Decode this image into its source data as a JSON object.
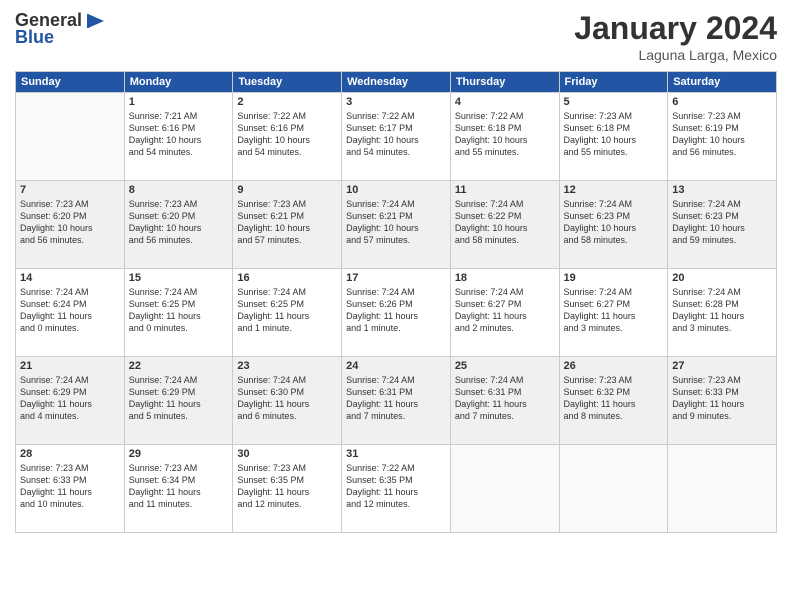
{
  "logo": {
    "text_general": "General",
    "text_blue": "Blue"
  },
  "header": {
    "month": "January 2024",
    "location": "Laguna Larga, Mexico"
  },
  "weekdays": [
    "Sunday",
    "Monday",
    "Tuesday",
    "Wednesday",
    "Thursday",
    "Friday",
    "Saturday"
  ],
  "weeks": [
    [
      {
        "day": "",
        "info": ""
      },
      {
        "day": "1",
        "info": "Sunrise: 7:21 AM\nSunset: 6:16 PM\nDaylight: 10 hours\nand 54 minutes."
      },
      {
        "day": "2",
        "info": "Sunrise: 7:22 AM\nSunset: 6:16 PM\nDaylight: 10 hours\nand 54 minutes."
      },
      {
        "day": "3",
        "info": "Sunrise: 7:22 AM\nSunset: 6:17 PM\nDaylight: 10 hours\nand 54 minutes."
      },
      {
        "day": "4",
        "info": "Sunrise: 7:22 AM\nSunset: 6:18 PM\nDaylight: 10 hours\nand 55 minutes."
      },
      {
        "day": "5",
        "info": "Sunrise: 7:23 AM\nSunset: 6:18 PM\nDaylight: 10 hours\nand 55 minutes."
      },
      {
        "day": "6",
        "info": "Sunrise: 7:23 AM\nSunset: 6:19 PM\nDaylight: 10 hours\nand 56 minutes."
      }
    ],
    [
      {
        "day": "7",
        "info": "Sunrise: 7:23 AM\nSunset: 6:20 PM\nDaylight: 10 hours\nand 56 minutes."
      },
      {
        "day": "8",
        "info": "Sunrise: 7:23 AM\nSunset: 6:20 PM\nDaylight: 10 hours\nand 56 minutes."
      },
      {
        "day": "9",
        "info": "Sunrise: 7:23 AM\nSunset: 6:21 PM\nDaylight: 10 hours\nand 57 minutes."
      },
      {
        "day": "10",
        "info": "Sunrise: 7:24 AM\nSunset: 6:21 PM\nDaylight: 10 hours\nand 57 minutes."
      },
      {
        "day": "11",
        "info": "Sunrise: 7:24 AM\nSunset: 6:22 PM\nDaylight: 10 hours\nand 58 minutes."
      },
      {
        "day": "12",
        "info": "Sunrise: 7:24 AM\nSunset: 6:23 PM\nDaylight: 10 hours\nand 58 minutes."
      },
      {
        "day": "13",
        "info": "Sunrise: 7:24 AM\nSunset: 6:23 PM\nDaylight: 10 hours\nand 59 minutes."
      }
    ],
    [
      {
        "day": "14",
        "info": "Sunrise: 7:24 AM\nSunset: 6:24 PM\nDaylight: 11 hours\nand 0 minutes."
      },
      {
        "day": "15",
        "info": "Sunrise: 7:24 AM\nSunset: 6:25 PM\nDaylight: 11 hours\nand 0 minutes."
      },
      {
        "day": "16",
        "info": "Sunrise: 7:24 AM\nSunset: 6:25 PM\nDaylight: 11 hours\nand 1 minute."
      },
      {
        "day": "17",
        "info": "Sunrise: 7:24 AM\nSunset: 6:26 PM\nDaylight: 11 hours\nand 1 minute."
      },
      {
        "day": "18",
        "info": "Sunrise: 7:24 AM\nSunset: 6:27 PM\nDaylight: 11 hours\nand 2 minutes."
      },
      {
        "day": "19",
        "info": "Sunrise: 7:24 AM\nSunset: 6:27 PM\nDaylight: 11 hours\nand 3 minutes."
      },
      {
        "day": "20",
        "info": "Sunrise: 7:24 AM\nSunset: 6:28 PM\nDaylight: 11 hours\nand 3 minutes."
      }
    ],
    [
      {
        "day": "21",
        "info": "Sunrise: 7:24 AM\nSunset: 6:29 PM\nDaylight: 11 hours\nand 4 minutes."
      },
      {
        "day": "22",
        "info": "Sunrise: 7:24 AM\nSunset: 6:29 PM\nDaylight: 11 hours\nand 5 minutes."
      },
      {
        "day": "23",
        "info": "Sunrise: 7:24 AM\nSunset: 6:30 PM\nDaylight: 11 hours\nand 6 minutes."
      },
      {
        "day": "24",
        "info": "Sunrise: 7:24 AM\nSunset: 6:31 PM\nDaylight: 11 hours\nand 7 minutes."
      },
      {
        "day": "25",
        "info": "Sunrise: 7:24 AM\nSunset: 6:31 PM\nDaylight: 11 hours\nand 7 minutes."
      },
      {
        "day": "26",
        "info": "Sunrise: 7:23 AM\nSunset: 6:32 PM\nDaylight: 11 hours\nand 8 minutes."
      },
      {
        "day": "27",
        "info": "Sunrise: 7:23 AM\nSunset: 6:33 PM\nDaylight: 11 hours\nand 9 minutes."
      }
    ],
    [
      {
        "day": "28",
        "info": "Sunrise: 7:23 AM\nSunset: 6:33 PM\nDaylight: 11 hours\nand 10 minutes."
      },
      {
        "day": "29",
        "info": "Sunrise: 7:23 AM\nSunset: 6:34 PM\nDaylight: 11 hours\nand 11 minutes."
      },
      {
        "day": "30",
        "info": "Sunrise: 7:23 AM\nSunset: 6:35 PM\nDaylight: 11 hours\nand 12 minutes."
      },
      {
        "day": "31",
        "info": "Sunrise: 7:22 AM\nSunset: 6:35 PM\nDaylight: 11 hours\nand 12 minutes."
      },
      {
        "day": "",
        "info": ""
      },
      {
        "day": "",
        "info": ""
      },
      {
        "day": "",
        "info": ""
      }
    ]
  ]
}
